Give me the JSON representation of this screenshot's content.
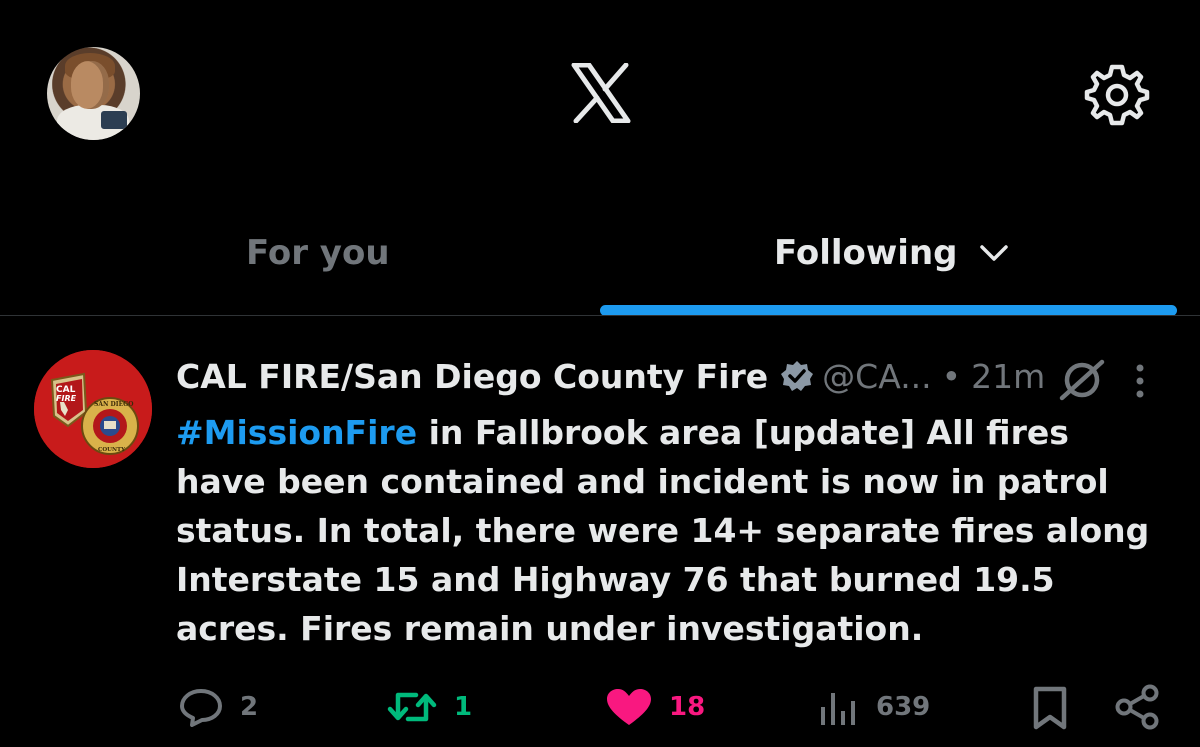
{
  "header": {
    "logo_icon": "x-logo-icon",
    "settings_icon": "gear-icon"
  },
  "tabs": [
    {
      "label": "For you",
      "active": false
    },
    {
      "label": "Following",
      "active": true
    }
  ],
  "post": {
    "author": "CAL FIRE/San Diego County Fire",
    "handle": "@CA...",
    "separator": "•",
    "time": "21m",
    "verified": true,
    "avatar_text": {
      "top": "CAL",
      "middle": "FIRE",
      "ring": "SAN DIEGO",
      "bottom": "COUNTY"
    },
    "hashtag": "#MissionFire",
    "text": " in Fallbrook area [update] All fires have been contained and incident is now in patrol status. In total, there were 14+ separate fires along Interstate 15 and Highway 76 that burned 19.5 acres. Fires remain under investigation.",
    "stats": {
      "replies": "2",
      "reposts": "1",
      "likes": "18",
      "views": "639"
    }
  },
  "colors": {
    "background": "#000000",
    "accent": "#1d9bf0",
    "muted": "#71767b",
    "repost_green": "#00ba7c",
    "like_pink": "#f91880",
    "avatar_red": "#c81b1b"
  }
}
